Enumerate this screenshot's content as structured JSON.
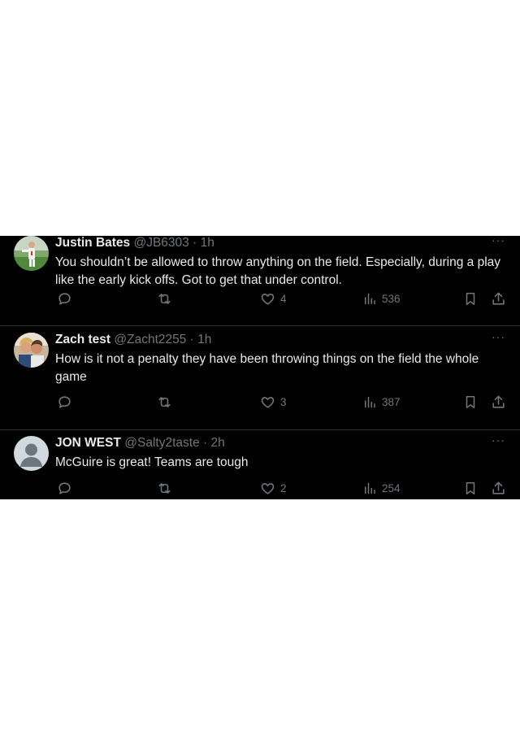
{
  "tweets": [
    {
      "name": "Justin Bates",
      "handle": "@JB6303",
      "dot": "·",
      "time": "1h",
      "more": "···",
      "text": "You shouldn’t be allowed to throw anything on the field.  Especially, during a play like the early kick offs.  Got to get that under control.",
      "likes": "4",
      "views": "536",
      "avatar_icon": "baseball-player-photo"
    },
    {
      "name": "Zach test",
      "handle": "@Zacht2255",
      "dot": "·",
      "time": "1h",
      "more": "···",
      "text": "How is it not a penalty they have been throwing things on the field the whole game",
      "likes": "3",
      "views": "387",
      "avatar_icon": "couple-photo"
    },
    {
      "name": "JON WEST",
      "handle": "@Salty2taste",
      "dot": "·",
      "time": "2h",
      "more": "···",
      "text": "McGuire is great!  Teams are tough",
      "likes": "2",
      "views": "254",
      "avatar_icon": "default-avatar-icon"
    }
  ],
  "colors": {
    "background": "#000000",
    "text": "#e7e9ea",
    "muted": "#71767b",
    "divider": "#2f3336"
  }
}
